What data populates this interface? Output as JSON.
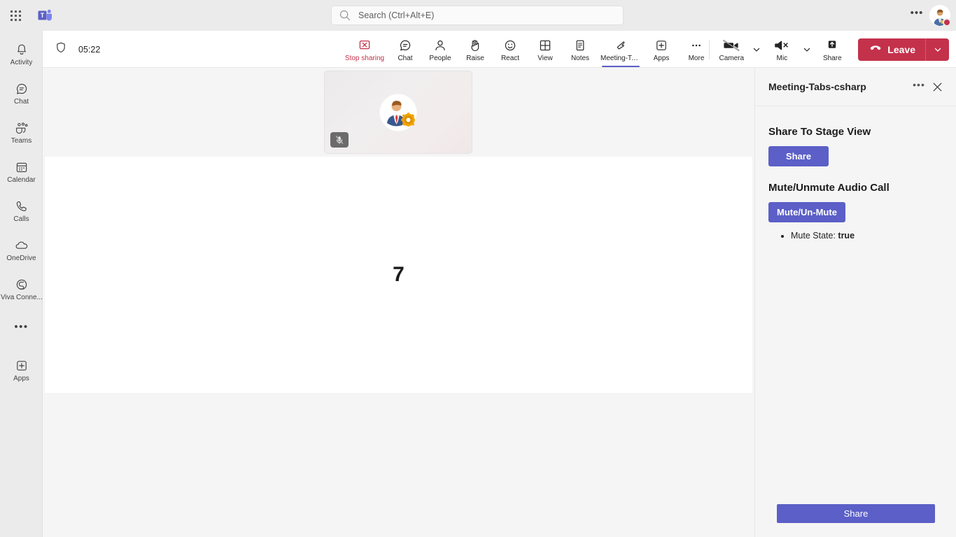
{
  "topbar": {
    "waffle_name": "app-launcher",
    "logo_name": "teams-logo",
    "search": {
      "placeholder": "Search (Ctrl+Alt+E)",
      "value": ""
    },
    "more_label": "•••",
    "avatar_name": "user-avatar",
    "presence": "busy"
  },
  "rail": {
    "items": [
      {
        "label": "Activity",
        "icon": "bell-icon"
      },
      {
        "label": "Chat",
        "icon": "chat-icon"
      },
      {
        "label": "Teams",
        "icon": "teams-icon"
      },
      {
        "label": "Calendar",
        "icon": "calendar-icon"
      },
      {
        "label": "Calls",
        "icon": "phone-icon"
      },
      {
        "label": "OneDrive",
        "icon": "cloud-icon"
      },
      {
        "label": "Viva Conne...",
        "icon": "viva-connections-icon"
      }
    ],
    "more_label": "•••",
    "apps": {
      "label": "Apps",
      "icon": "plus-square-icon"
    }
  },
  "meeting": {
    "shield_icon": "shield-icon",
    "timer": "05:22",
    "tools": [
      {
        "label": "Stop sharing",
        "icon": "stop-sharing-icon",
        "state": "active-red"
      },
      {
        "label": "Chat",
        "icon": "chat-icon"
      },
      {
        "label": "People",
        "icon": "person-icon"
      },
      {
        "label": "Raise",
        "icon": "raise-hand-icon"
      },
      {
        "label": "React",
        "icon": "smiley-icon"
      },
      {
        "label": "View",
        "icon": "grid-view-icon"
      },
      {
        "label": "Notes",
        "icon": "notes-icon"
      },
      {
        "label": "Meeting-Tab...",
        "icon": "meeting-tab-icon",
        "state": "selected"
      },
      {
        "label": "Apps",
        "icon": "plus-square-icon"
      },
      {
        "label": "More",
        "icon": "ellipsis-icon"
      }
    ],
    "camera": {
      "label": "Camera",
      "icon": "camera-off-icon",
      "state": "off"
    },
    "mic": {
      "label": "Mic",
      "icon": "mic-muted-icon",
      "state": "muted"
    },
    "share": {
      "label": "Share",
      "icon": "share-screen-icon"
    },
    "leave": {
      "label": "Leave",
      "icon": "hang-up-icon",
      "color": "#c4314b"
    }
  },
  "stage": {
    "video_tile": {
      "name": "participant-video-tile",
      "avatar_icon": "user-gear-avatar",
      "mute_badge_icon": "mic-muted-icon"
    },
    "shared_content": {
      "number": "7"
    }
  },
  "panel": {
    "title": "Meeting-Tabs-csharp",
    "more_label": "•••",
    "close_icon": "close-icon",
    "sections": [
      {
        "heading": "Share To Stage View",
        "button": "Share"
      },
      {
        "heading": "Mute/Unmute Audio Call",
        "button": "Mute/Un-Mute"
      }
    ],
    "mute_state_label": "Mute State: ",
    "mute_state_value": "true",
    "footer_button": "Share"
  },
  "colors": {
    "accent_purple": "#5b5fc7",
    "leave_red": "#c4314b",
    "stop_sharing_red": "#c4314b",
    "chrome_gray": "#ebebeb",
    "stage_gray": "#f5f5f5"
  }
}
